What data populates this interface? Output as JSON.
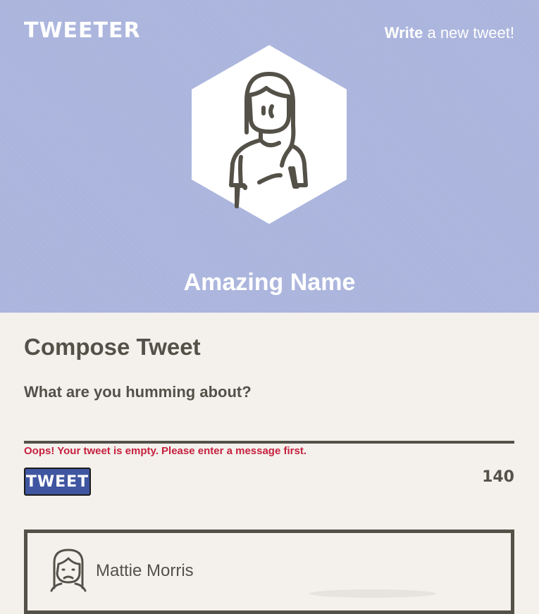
{
  "nav": {
    "logo": "TWEETER",
    "write_strong": "Write",
    "write_rest": " a new tweet!"
  },
  "profile": {
    "name": "Amazing Name",
    "avatar_icon": "female-user-avatar-icon"
  },
  "compose": {
    "title": "Compose Tweet",
    "label": "What are you humming about?",
    "input_value": "",
    "error": "Oops! Your tweet is empty. Please enter a message first.",
    "button_label": "TWEET",
    "counter": "140"
  },
  "tweets": [
    {
      "user": "Mattie Morris",
      "avatar_icon": "sad-female-avatar-icon"
    }
  ],
  "colors": {
    "header_bg": "#a9b3dc",
    "page_bg": "#f4f1ec",
    "text": "#545149",
    "button_bg": "#4056a1",
    "error": "#c6213f"
  }
}
